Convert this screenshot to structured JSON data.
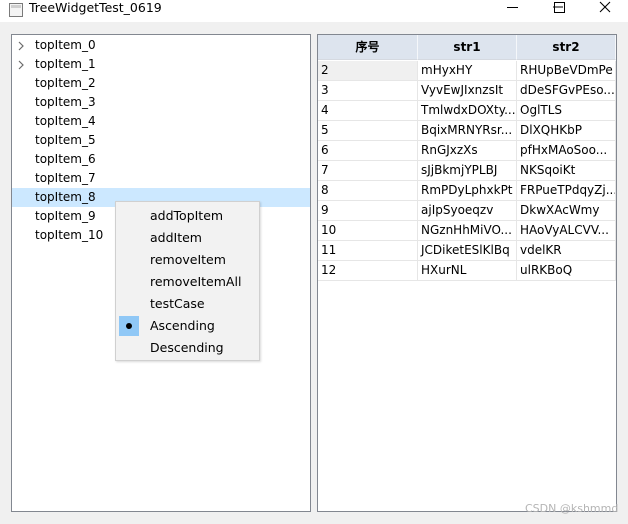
{
  "window": {
    "title": "TreeWidgetTest_0619",
    "minimize_icon": "minimize-icon",
    "maximize_icon": "maximize-icon",
    "close_icon": "close-icon"
  },
  "tree": {
    "items": [
      {
        "label": "topItem_0",
        "has_children": true
      },
      {
        "label": "topItem_1",
        "has_children": true
      },
      {
        "label": "topItem_2",
        "has_children": false
      },
      {
        "label": "topItem_3",
        "has_children": false
      },
      {
        "label": "topItem_4",
        "has_children": false
      },
      {
        "label": "topItem_5",
        "has_children": false
      },
      {
        "label": "topItem_6",
        "has_children": false
      },
      {
        "label": "topItem_7",
        "has_children": false
      },
      {
        "label": "topItem_8",
        "has_children": false,
        "selected": true
      },
      {
        "label": "topItem_9",
        "has_children": false
      },
      {
        "label": "topItem_10",
        "has_children": false
      }
    ]
  },
  "table": {
    "headers": [
      "序号",
      "str1",
      "str2"
    ],
    "rows": [
      [
        "2",
        "mHyxHY",
        "RHUpBeVDmPe"
      ],
      [
        "3",
        "VyvEwJIxnzsIt",
        "dDeSFGvPEso..."
      ],
      [
        "4",
        "TmlwdxDOXty...",
        "OglTLS"
      ],
      [
        "5",
        "BqixMRNYRsr...",
        "DlXQHKbP"
      ],
      [
        "6",
        "RnGJxzXs",
        "pfHxMAoSoo..."
      ],
      [
        "7",
        "sJjBkmjYPLBJ",
        "NKSqoiKt"
      ],
      [
        "8",
        "RmPDyLphxkPt",
        "FRPueTPdqyZj..."
      ],
      [
        "9",
        "ajIpSyoeqzv",
        "DkwXAcWmy"
      ],
      [
        "10",
        "NGznHhMiVO...",
        "HAoVyALCVV..."
      ],
      [
        "11",
        "JCDiketESlKlBq",
        "vdelKR"
      ],
      [
        "12",
        "HXurNL",
        "ulRKBoQ"
      ]
    ]
  },
  "context_menu": {
    "items": [
      {
        "label": "addTopItem",
        "checked": false
      },
      {
        "label": "addItem",
        "checked": false
      },
      {
        "label": "removeItem",
        "checked": false
      },
      {
        "label": "removeItemAll",
        "checked": false
      },
      {
        "label": "testCase",
        "checked": false
      },
      {
        "label": "Ascending",
        "checked": true
      },
      {
        "label": "Descending",
        "checked": false
      }
    ]
  },
  "watermark": "CSDN @kshmmd",
  "colors": {
    "selection": "#cce8ff",
    "header_bg": "#dde4ee",
    "menu_check": "#90c8f6",
    "window_bg": "#f0f0f0"
  }
}
